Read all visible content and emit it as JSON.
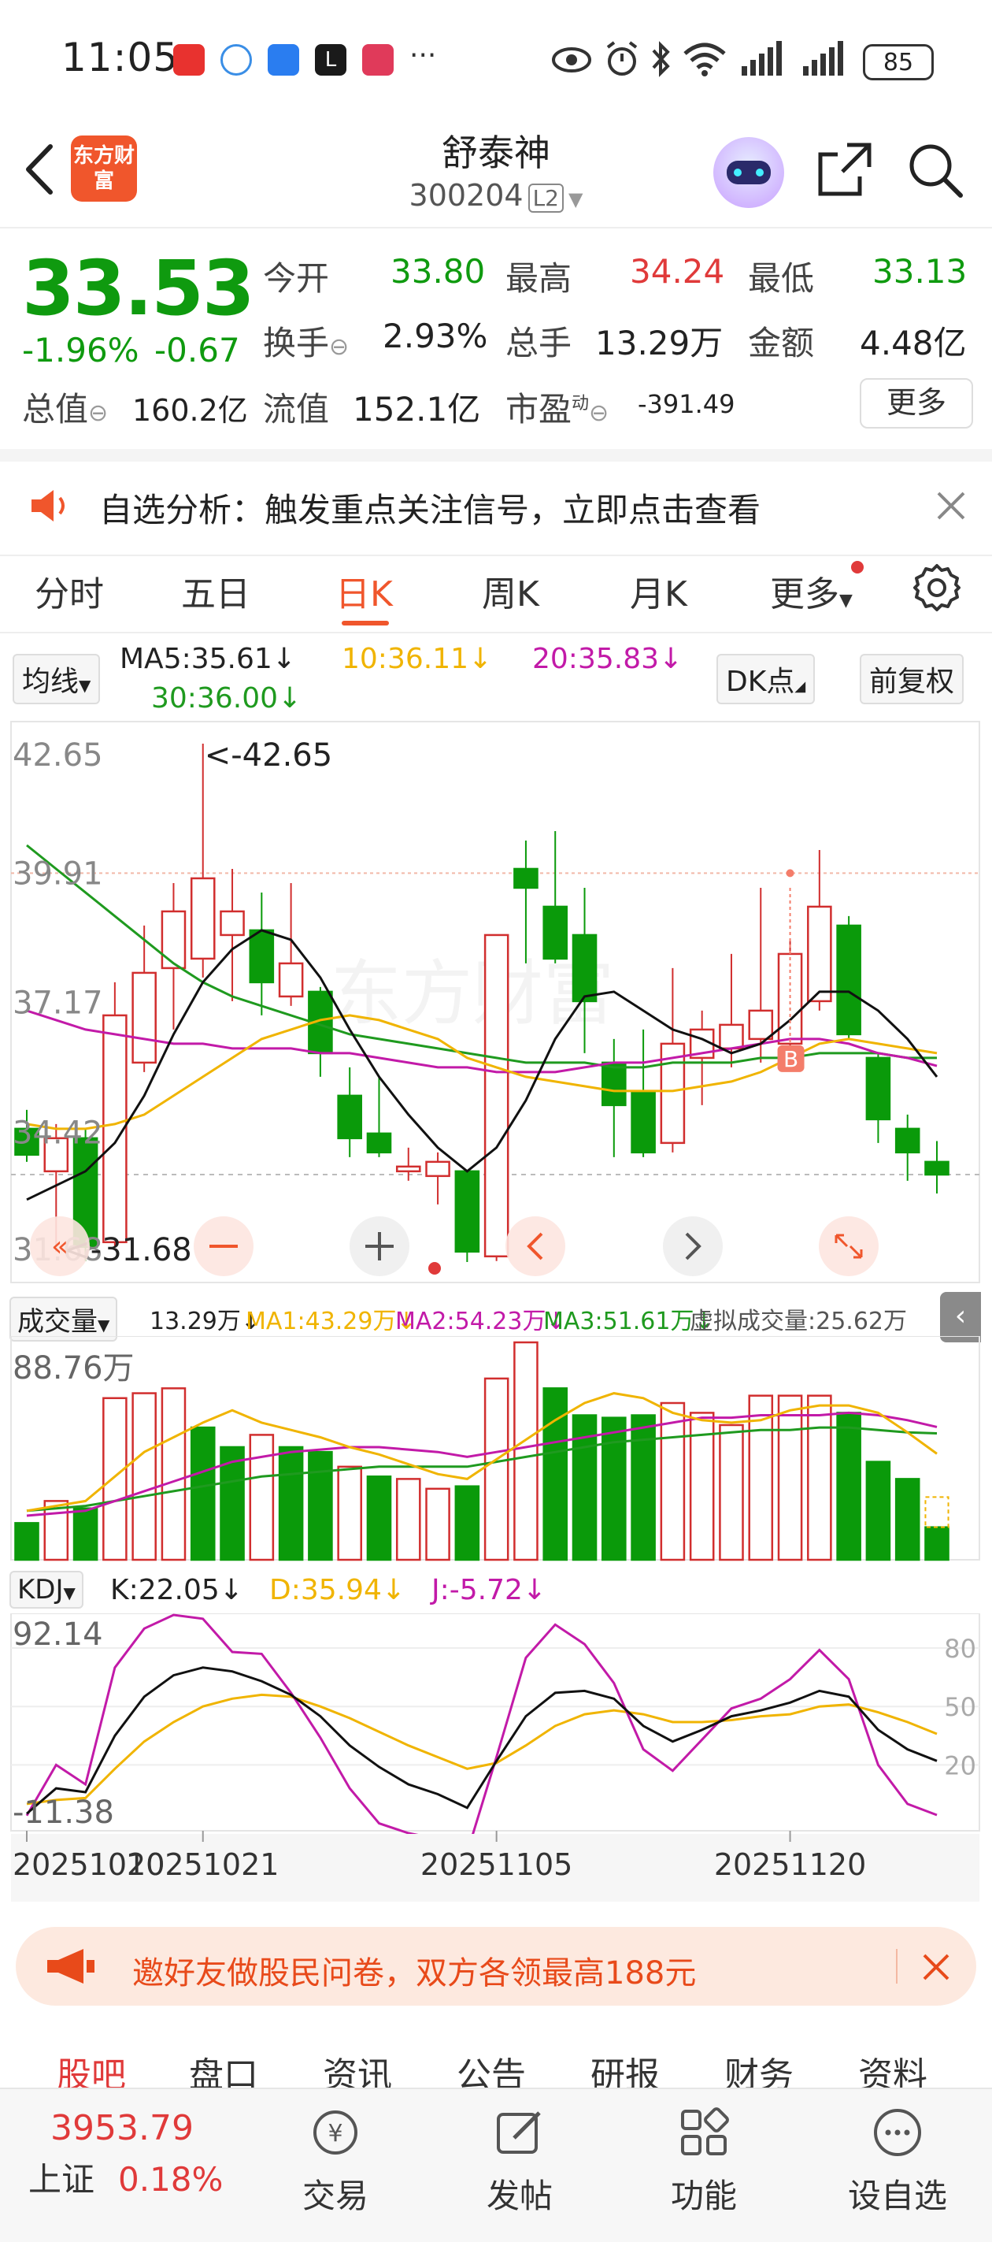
{
  "status_bar": {
    "time": "11:05",
    "battery": "85",
    "more": "···"
  },
  "header": {
    "title": "舒泰神",
    "code": "300204",
    "level": "L2",
    "logo_text": "东方财富"
  },
  "quote": {
    "price": "33.53",
    "change_pct": "-1.96%",
    "change": "-0.67",
    "open_label": "今开",
    "open": "33.80",
    "high_label": "最高",
    "high": "34.24",
    "low_label": "最低",
    "low": "33.13",
    "turnover_label": "换手",
    "turnover": "2.93%",
    "volume_label": "总手",
    "volume": "13.29万",
    "amount_label": "金额",
    "amount": "4.48亿",
    "total_mv_label": "总值",
    "total_mv": "160.2亿",
    "float_mv_label": "流值",
    "float_mv": "152.1亿",
    "pe_label": "市盈",
    "pe_sup": "动",
    "pe": "-391.49",
    "more_label": "更多"
  },
  "alert": {
    "text": "自选分析：触发重点关注信号，立即点击查看"
  },
  "tabs": [
    "分时",
    "五日",
    "日K",
    "周K",
    "月K",
    "更多"
  ],
  "active_tab": "日K",
  "ma_legend": {
    "type": "均线",
    "ma5": "MA5:35.61↓",
    "ma10": "10:36.11↓",
    "ma20": "20:35.83↓",
    "ma30": "30:36.00↓",
    "dk": "DK点",
    "adjust": "前复权"
  },
  "chart_data": [
    {
      "type": "candlestick",
      "y_axis_labels": [
        "42.65",
        "39.91",
        "37.17",
        "34.42",
        "31.68"
      ],
      "ylim": [
        31.68,
        42.65
      ],
      "max_marker": "<-42.65",
      "min_marker": "<-31.68",
      "x_labels": [
        "20251010",
        "20251021",
        "20251105",
        "20251120"
      ],
      "signal_marker": "B",
      "candles": [
        {
          "o": 34.5,
          "h": 34.9,
          "l": 33.8,
          "c": 33.95
        },
        {
          "o": 33.6,
          "h": 34.6,
          "l": 31.9,
          "c": 34.3
        },
        {
          "o": 34.3,
          "h": 34.5,
          "l": 31.7,
          "c": 32.0
        },
        {
          "o": 32.1,
          "h": 37.6,
          "l": 32.0,
          "c": 36.9
        },
        {
          "o": 35.9,
          "h": 38.8,
          "l": 35.7,
          "c": 37.8
        },
        {
          "o": 37.9,
          "h": 39.7,
          "l": 36.6,
          "c": 39.1
        },
        {
          "o": 38.1,
          "h": 42.65,
          "l": 37.7,
          "c": 39.8
        },
        {
          "o": 38.6,
          "h": 40.0,
          "l": 37.2,
          "c": 39.1
        },
        {
          "o": 38.7,
          "h": 39.5,
          "l": 36.9,
          "c": 37.6
        },
        {
          "o": 37.3,
          "h": 39.7,
          "l": 37.1,
          "c": 38.0
        },
        {
          "o": 37.4,
          "h": 37.5,
          "l": 35.6,
          "c": 36.1
        },
        {
          "o": 35.2,
          "h": 35.8,
          "l": 33.9,
          "c": 34.3
        },
        {
          "o": 34.4,
          "h": 35.6,
          "l": 33.9,
          "c": 34.0
        },
        {
          "o": 33.6,
          "h": 34.1,
          "l": 33.4,
          "c": 33.7
        },
        {
          "o": 33.5,
          "h": 34.0,
          "l": 32.9,
          "c": 33.8
        },
        {
          "o": 33.6,
          "h": 33.6,
          "l": 31.68,
          "c": 31.9
        },
        {
          "o": 31.8,
          "h": 38.6,
          "l": 31.7,
          "c": 38.6
        },
        {
          "o": 40.0,
          "h": 40.6,
          "l": 38.0,
          "c": 39.6
        },
        {
          "o": 39.2,
          "h": 40.8,
          "l": 38.0,
          "c": 38.1
        },
        {
          "o": 38.6,
          "h": 39.6,
          "l": 36.1,
          "c": 37.2
        },
        {
          "o": 35.9,
          "h": 36.4,
          "l": 33.9,
          "c": 35.0
        },
        {
          "o": 35.3,
          "h": 36.6,
          "l": 33.9,
          "c": 34.0
        },
        {
          "o": 34.2,
          "h": 37.9,
          "l": 34.0,
          "c": 36.3
        },
        {
          "o": 36.0,
          "h": 37.0,
          "l": 35.0,
          "c": 36.6
        },
        {
          "o": 36.2,
          "h": 38.2,
          "l": 35.8,
          "c": 36.7
        },
        {
          "o": 36.4,
          "h": 39.6,
          "l": 35.9,
          "c": 37.0
        },
        {
          "o": 36.3,
          "h": 38.5,
          "l": 35.8,
          "c": 38.2
        },
        {
          "o": 37.2,
          "h": 40.4,
          "l": 37.0,
          "c": 39.2
        },
        {
          "o": 38.8,
          "h": 39.0,
          "l": 36.4,
          "c": 36.5
        },
        {
          "o": 36.0,
          "h": 36.1,
          "l": 34.2,
          "c": 34.7
        },
        {
          "o": 34.5,
          "h": 34.8,
          "l": 33.4,
          "c": 34.0
        },
        {
          "o": 33.8,
          "h": 34.24,
          "l": 33.13,
          "c": 33.53
        }
      ],
      "ma5": [
        33.0,
        33.3,
        33.6,
        34.2,
        35.2,
        36.5,
        37.6,
        38.3,
        38.7,
        38.5,
        37.7,
        36.6,
        35.6,
        34.8,
        34.1,
        33.6,
        34.1,
        35.1,
        36.4,
        37.3,
        37.4,
        37.0,
        36.6,
        36.4,
        36.1,
        36.3,
        36.8,
        37.4,
        37.4,
        37.0,
        36.4,
        35.6
      ],
      "ma10": [
        34.6,
        34.5,
        34.5,
        34.6,
        34.8,
        35.2,
        35.6,
        36.0,
        36.4,
        36.6,
        36.8,
        36.9,
        36.8,
        36.6,
        36.4,
        36.0,
        35.8,
        35.6,
        35.5,
        35.4,
        35.3,
        35.3,
        35.3,
        35.4,
        35.5,
        35.7,
        36.0,
        36.3,
        36.4,
        36.3,
        36.2,
        36.1
      ],
      "ma20": [
        37.0,
        36.8,
        36.6,
        36.5,
        36.4,
        36.3,
        36.3,
        36.2,
        36.2,
        36.2,
        36.1,
        36.1,
        36.0,
        35.9,
        35.8,
        35.8,
        35.7,
        35.7,
        35.7,
        35.8,
        35.9,
        35.9,
        36.0,
        36.1,
        36.2,
        36.3,
        36.4,
        36.4,
        36.3,
        36.1,
        36.0,
        35.83
      ],
      "ma30": [
        40.5,
        40.0,
        39.5,
        39.0,
        38.5,
        38.0,
        37.6,
        37.3,
        37.1,
        36.9,
        36.7,
        36.5,
        36.4,
        36.3,
        36.2,
        36.1,
        36.0,
        35.9,
        35.9,
        35.9,
        35.8,
        35.8,
        35.9,
        35.9,
        35.9,
        36.0,
        36.0,
        36.1,
        36.1,
        36.1,
        36.0,
        36.0
      ]
    },
    {
      "type": "bar",
      "title": "成交量",
      "y_axis_labels": [
        "88.76万"
      ],
      "ylim": [
        0,
        88.76
      ],
      "values": [
        15,
        24,
        21,
        66,
        68,
        70,
        54,
        46,
        51,
        46,
        44,
        38,
        34,
        33,
        29,
        30,
        74,
        88.76,
        70,
        59,
        58,
        59,
        64,
        60,
        55,
        67,
        67,
        67,
        60,
        40,
        33,
        13.29
      ],
      "up": [
        false,
        true,
        false,
        true,
        true,
        true,
        false,
        false,
        true,
        false,
        false,
        true,
        false,
        true,
        true,
        false,
        true,
        true,
        false,
        false,
        false,
        false,
        true,
        true,
        true,
        true,
        true,
        true,
        false,
        false,
        false,
        false
      ],
      "ma1": [
        20,
        22,
        24,
        34,
        44,
        50,
        56,
        61,
        56,
        53,
        50,
        46,
        43,
        39,
        35,
        33,
        41,
        49,
        57,
        64,
        68,
        66,
        60,
        57,
        56,
        57,
        61,
        63,
        63,
        60,
        52,
        43.29
      ],
      "ma2": [
        18,
        19,
        20,
        24,
        28,
        32,
        36,
        40,
        42,
        44,
        45,
        46,
        46,
        45,
        44,
        42,
        44,
        46,
        48,
        50,
        52,
        54,
        56,
        58,
        58,
        59,
        59,
        59,
        60,
        59,
        57,
        54.23
      ],
      "ma3": [
        20,
        21,
        22,
        24,
        26,
        28,
        30,
        32,
        34,
        35,
        36,
        37,
        38,
        38,
        38,
        38,
        40,
        42,
        44,
        46,
        48,
        49,
        50,
        51,
        52,
        53,
        53,
        54,
        54,
        53,
        52,
        51.61
      ]
    },
    {
      "type": "line",
      "title": "KDJ",
      "y_axis_labels": [
        "92.14",
        "-11.38"
      ],
      "right_axis_labels": [
        "80",
        "50",
        "20"
      ],
      "ylim": [
        -11.38,
        92.14
      ],
      "k": [
        -5,
        8,
        6,
        35,
        55,
        66,
        70,
        68,
        63,
        56,
        45,
        30,
        19,
        10,
        5,
        -2,
        22,
        45,
        57,
        58,
        54,
        40,
        32,
        38,
        45,
        48,
        52,
        58,
        55,
        38,
        28,
        22.05
      ],
      "d": [
        0,
        2,
        3,
        18,
        32,
        42,
        50,
        54,
        56,
        55,
        50,
        44,
        37,
        30,
        24,
        18,
        21,
        30,
        40,
        46,
        48,
        46,
        42,
        42,
        43,
        45,
        46,
        50,
        51,
        47,
        42,
        35.94
      ],
      "j": [
        -6,
        20,
        10,
        70,
        90,
        97,
        95,
        78,
        77,
        57,
        34,
        8,
        -10,
        -15,
        -18,
        -25,
        24,
        75,
        92,
        82,
        62,
        28,
        17,
        33,
        49,
        54,
        64,
        79,
        64,
        20,
        0,
        -5.72
      ]
    }
  ],
  "volume_legend": {
    "label": "成交量",
    "vol": "13.29万↓",
    "ma1": "MA1:43.29万↓",
    "ma2": "MA2:54.23万↓",
    "ma3": "MA3:51.61万↓",
    "virtual": "虚拟成交量:25.62万"
  },
  "kdj_legend": {
    "label": "KDJ",
    "k": "K:22.05↓",
    "d": "D:35.94↓",
    "j": "J:-5.72↓"
  },
  "watermark": "东方财富",
  "promo": {
    "text": "邀好友做股民问卷，双方各领最高188元"
  },
  "subtabs": [
    "股吧",
    "盘口",
    "资讯",
    "公告",
    "研报",
    "财务",
    "资料"
  ],
  "bottom": {
    "index_value": "3953.79",
    "index_name": "上证",
    "index_change": "0.18%",
    "items": [
      "交易",
      "发帖",
      "功能",
      "设自选"
    ]
  },
  "colors": {
    "up": "#d12e2e",
    "down": "#0a9a0a",
    "ma5": "#111111",
    "ma10": "#f0b400",
    "ma20": "#c21aa8",
    "ma30": "#1f9a1f",
    "accent": "#f0562c"
  }
}
